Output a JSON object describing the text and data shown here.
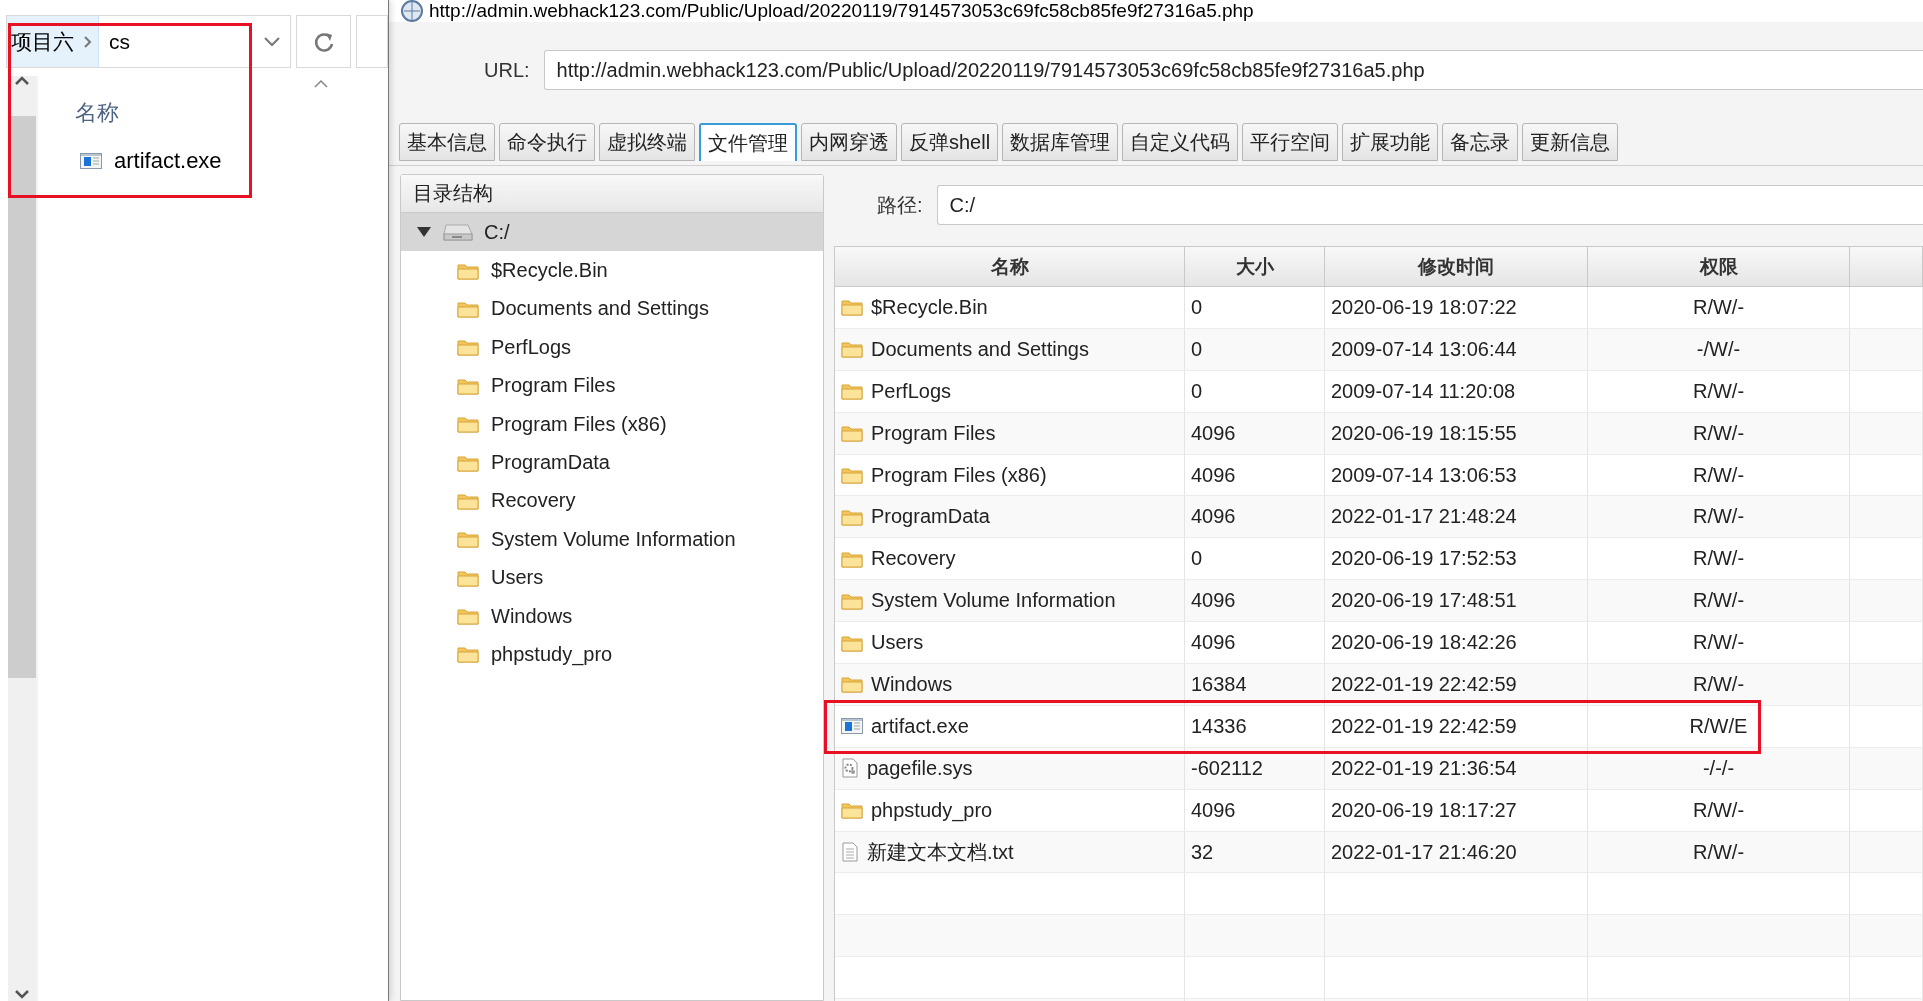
{
  "explorer": {
    "breadcrumb": [
      {
        "label": "项目六"
      },
      {
        "label": "cs"
      }
    ],
    "column": "名称",
    "files": [
      {
        "name": "artifact.exe",
        "kind": "exe"
      }
    ],
    "highlighted": true
  },
  "app": {
    "title": "http://admin.webhack123.com/Public/Upload/20220119/7914573053c69fc58cb85fe9f27316a5.php",
    "url_label": "URL:",
    "url": "http://admin.webhack123.com/Public/Upload/20220119/7914573053c69fc58cb85fe9f27316a5.php",
    "tabs": [
      {
        "label": "基本信息",
        "selected": false
      },
      {
        "label": "命令执行",
        "selected": false
      },
      {
        "label": "虚拟终端",
        "selected": false
      },
      {
        "label": "文件管理",
        "selected": true
      },
      {
        "label": "内网穿透",
        "selected": false
      },
      {
        "label": "反弹shell",
        "selected": false
      },
      {
        "label": "数据库管理",
        "selected": false
      },
      {
        "label": "自定义代码",
        "selected": false
      },
      {
        "label": "平行空间",
        "selected": false
      },
      {
        "label": "扩展功能",
        "selected": false
      },
      {
        "label": "备忘录",
        "selected": false
      },
      {
        "label": "更新信息",
        "selected": false
      }
    ],
    "tree": {
      "title": "目录结构",
      "root": {
        "label": "C:/",
        "expanded": true,
        "selected": true,
        "children": [
          {
            "label": "$Recycle.Bin"
          },
          {
            "label": "Documents and Settings"
          },
          {
            "label": "PerfLogs"
          },
          {
            "label": "Program Files"
          },
          {
            "label": "Program Files (x86)"
          },
          {
            "label": "ProgramData"
          },
          {
            "label": "Recovery"
          },
          {
            "label": "System Volume Information"
          },
          {
            "label": "Users"
          },
          {
            "label": "Windows"
          },
          {
            "label": "phpstudy_pro"
          }
        ]
      }
    },
    "path_label": "路径:",
    "path": "C:/",
    "table": {
      "columns": [
        "名称",
        "大小",
        "修改时间",
        "权限"
      ],
      "rows": [
        {
          "kind": "folder",
          "name": "$Recycle.Bin",
          "size": "0",
          "modified": "2020-06-19 18:07:22",
          "permissions": "R/W/-",
          "highlighted": false
        },
        {
          "kind": "folder",
          "name": "Documents and Settings",
          "size": "0",
          "modified": "2009-07-14 13:06:44",
          "permissions": "-/W/-",
          "highlighted": false
        },
        {
          "kind": "folder",
          "name": "PerfLogs",
          "size": "0",
          "modified": "2009-07-14 11:20:08",
          "permissions": "R/W/-",
          "highlighted": false
        },
        {
          "kind": "folder",
          "name": "Program Files",
          "size": "4096",
          "modified": "2020-06-19 18:15:55",
          "permissions": "R/W/-",
          "highlighted": false
        },
        {
          "kind": "folder",
          "name": "Program Files (x86)",
          "size": "4096",
          "modified": "2009-07-14 13:06:53",
          "permissions": "R/W/-",
          "highlighted": false
        },
        {
          "kind": "folder",
          "name": "ProgramData",
          "size": "4096",
          "modified": "2022-01-17 21:48:24",
          "permissions": "R/W/-",
          "highlighted": false
        },
        {
          "kind": "folder",
          "name": "Recovery",
          "size": "0",
          "modified": "2020-06-19 17:52:53",
          "permissions": "R/W/-",
          "highlighted": false
        },
        {
          "kind": "folder",
          "name": "System Volume Information",
          "size": "4096",
          "modified": "2020-06-19 17:48:51",
          "permissions": "R/W/-",
          "highlighted": false
        },
        {
          "kind": "folder",
          "name": "Users",
          "size": "4096",
          "modified": "2020-06-19 18:42:26",
          "permissions": "R/W/-",
          "highlighted": false
        },
        {
          "kind": "folder",
          "name": "Windows",
          "size": "16384",
          "modified": "2022-01-19 22:42:59",
          "permissions": "R/W/-",
          "highlighted": false
        },
        {
          "kind": "exe",
          "name": "artifact.exe",
          "size": "14336",
          "modified": "2022-01-19 22:42:59",
          "permissions": "R/W/E",
          "highlighted": true
        },
        {
          "kind": "sys",
          "name": "pagefile.sys",
          "size": "-602112",
          "modified": "2022-01-19 21:36:54",
          "permissions": "-/-/-",
          "highlighted": false
        },
        {
          "kind": "folder",
          "name": "phpstudy_pro",
          "size": "4096",
          "modified": "2020-06-19 18:17:27",
          "permissions": "R/W/-",
          "highlighted": false
        },
        {
          "kind": "txt",
          "name": "新建文本文档.txt",
          "size": "32",
          "modified": "2022-01-17 21:46:20",
          "permissions": "R/W/-",
          "highlighted": false
        }
      ]
    }
  }
}
